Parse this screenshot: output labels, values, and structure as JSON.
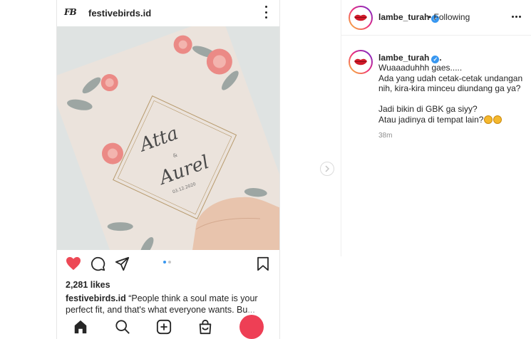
{
  "phone": {
    "header": {
      "logo_text": "FB",
      "username": "festivebirds.id"
    },
    "image": {
      "name_top": "Atta",
      "name_mid": "&",
      "name_bottom": "Aurel",
      "date": "03.12.2020"
    },
    "likes": "2,281 likes",
    "caption": {
      "username": "festivebirds.id",
      "text": " “People think a soul mate is your perfect fit, and that's what everyone wants. Bu",
      "more": "... more"
    }
  },
  "post": {
    "header": {
      "username": "lambe_turah",
      "separator": "•",
      "follow_status": "Following"
    },
    "comment": {
      "username": "lambe_turah",
      "after_badge": ".",
      "text": "Wuaaaduhhh gaes.....\nAda yang udah cetak-cetak undangan nih, kira-kira minceu diundang ga ya?\n\nJadi bikin di GBK ga siyy?\nAtau jadinya di tempat lain?",
      "time": "38m"
    }
  },
  "colors": {
    "accent_blue": "#3897f0",
    "like_red": "#ed4956",
    "record_red": "#ee3f55"
  },
  "icons": [
    "heart-icon",
    "comment-icon",
    "share-icon",
    "bookmark-icon",
    "home-icon",
    "search-icon",
    "add-icon",
    "shop-icon",
    "more-icon",
    "verified-icon",
    "chevron-right-icon"
  ]
}
